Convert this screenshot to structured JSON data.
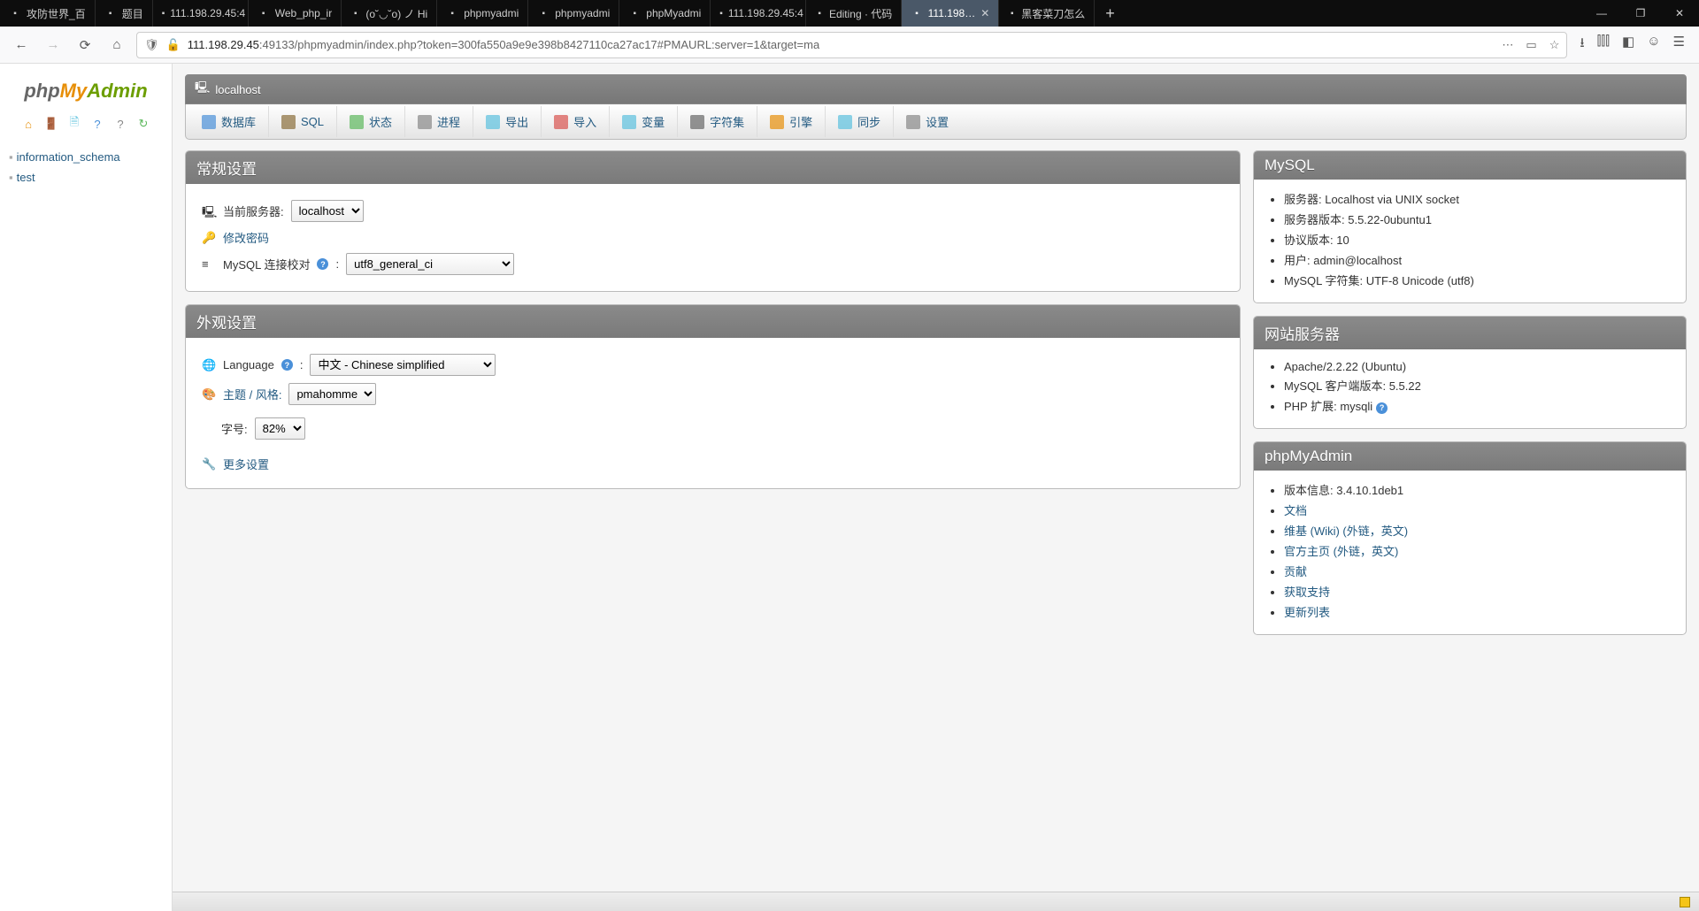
{
  "browser": {
    "tabs": [
      {
        "label": "攻防世界_百"
      },
      {
        "label": "题目"
      },
      {
        "label": "111.198.29.45:4"
      },
      {
        "label": "Web_php_ir"
      },
      {
        "label": "(o˘◡˘o) ノ Hi"
      },
      {
        "label": "phpmyadmi"
      },
      {
        "label": "phpmyadmi"
      },
      {
        "label": "phpMyadmi"
      },
      {
        "label": "111.198.29.45:4"
      },
      {
        "label": "Editing · 代码"
      },
      {
        "label": "111.198…",
        "active": true
      },
      {
        "label": "黑客菜刀怎么"
      }
    ],
    "url_host": "111.198.29.45",
    "url_path": ":49133/phpmyadmin/index.php?token=300fa550a9e9e398b8427110ca27ac17#PMAURL:server=1&target=ma"
  },
  "breadcrumb": "localhost",
  "topmenu": [
    {
      "label": "数据库",
      "color": "#4a90d9"
    },
    {
      "label": "SQL",
      "color": "#8a6d3b"
    },
    {
      "label": "状态",
      "color": "#5cb85c"
    },
    {
      "label": "进程",
      "color": "#888"
    },
    {
      "label": "导出",
      "color": "#5bc0de"
    },
    {
      "label": "导入",
      "color": "#d9534f"
    },
    {
      "label": "变量",
      "color": "#5bc0de"
    },
    {
      "label": "字符集",
      "color": "#666"
    },
    {
      "label": "引擎",
      "color": "#e78f08"
    },
    {
      "label": "同步",
      "color": "#5bc0de"
    },
    {
      "label": "设置",
      "color": "#888"
    }
  ],
  "sidebar": {
    "dbs": [
      "information_schema",
      "test"
    ]
  },
  "general": {
    "title": "常规设置",
    "server_label": "当前服务器:",
    "server_value": "localhost",
    "change_pw": "修改密码",
    "collation_label": "MySQL 连接校对",
    "collation_value": "utf8_general_ci"
  },
  "appearance": {
    "title": "外观设置",
    "lang_label": "Language",
    "lang_value": "中文 - Chinese simplified",
    "theme_label": "主题 / 风格:",
    "theme_value": "pmahomme",
    "font_label": "字号:",
    "font_value": "82%",
    "more": "更多设置"
  },
  "mysql": {
    "title": "MySQL",
    "items": [
      "服务器: Localhost via UNIX socket",
      "服务器版本: 5.5.22-0ubuntu1",
      "协议版本: 10",
      "用户: admin@localhost",
      "MySQL 字符集: UTF-8 Unicode (utf8)"
    ]
  },
  "webserver": {
    "title": "网站服务器",
    "items": [
      "Apache/2.2.22 (Ubuntu)",
      "MySQL 客户端版本: 5.5.22",
      "PHP 扩展: mysqli"
    ]
  },
  "pma": {
    "title": "phpMyAdmin",
    "version": "版本信息: 3.4.10.1deb1",
    "links": [
      "文档",
      "维基 (Wiki) (外链，英文)",
      "官方主页 (外链，英文)",
      "贡献",
      "获取支持",
      "更新列表"
    ]
  }
}
